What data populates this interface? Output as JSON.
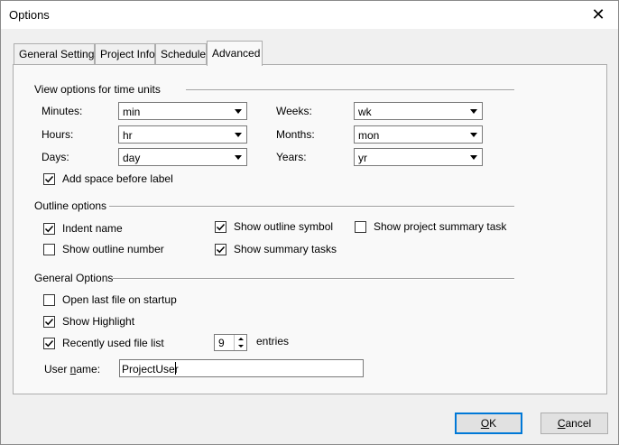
{
  "window": {
    "title": "Options"
  },
  "tabs": [
    {
      "label": "General Settings"
    },
    {
      "label": "Project Info"
    },
    {
      "label": "Schedule"
    },
    {
      "label": "Advanced",
      "active": true
    }
  ],
  "time_units": {
    "title": "View options for time units",
    "minutes": {
      "label": "Minutes:",
      "value": "min"
    },
    "hours": {
      "label": "Hours:",
      "value": "hr"
    },
    "days": {
      "label": "Days:",
      "value": "day"
    },
    "weeks": {
      "label": "Weeks:",
      "value": "wk"
    },
    "months": {
      "label": "Months:",
      "value": "mon"
    },
    "years": {
      "label": "Years:",
      "value": "yr"
    },
    "add_space": {
      "label": "Add space before label",
      "checked": true
    }
  },
  "outline": {
    "title": "Outline options",
    "indent_name": {
      "label": "Indent name",
      "checked": true
    },
    "show_outline_number": {
      "label": "Show outline number",
      "checked": false
    },
    "show_outline_symbol": {
      "label": "Show outline symbol",
      "checked": true
    },
    "show_summary_tasks": {
      "label": "Show summary tasks",
      "checked": true
    },
    "show_project_summary": {
      "label": "Show project summary task",
      "checked": false
    }
  },
  "general": {
    "title": "General Options",
    "open_last_file": {
      "label": "Open last file on startup",
      "checked": false
    },
    "show_highlight": {
      "label": "Show Highlight",
      "checked": true
    },
    "recent_files": {
      "label": "Recently used file list",
      "checked": true,
      "count": "9",
      "suffix": "entries"
    },
    "user_name": {
      "label_pre": "User ",
      "label_u": "n",
      "label_post": "ame:",
      "value": "ProjectUser"
    }
  },
  "buttons": {
    "ok": {
      "label_u": "O",
      "label_rest": "K"
    },
    "cancel": {
      "label_u": "C",
      "label_rest": "ancel"
    }
  },
  "colors": {
    "focus_border": "#0078d7",
    "panel_bg": "#f9f9f9",
    "window_bg": "#f0f0f0"
  }
}
